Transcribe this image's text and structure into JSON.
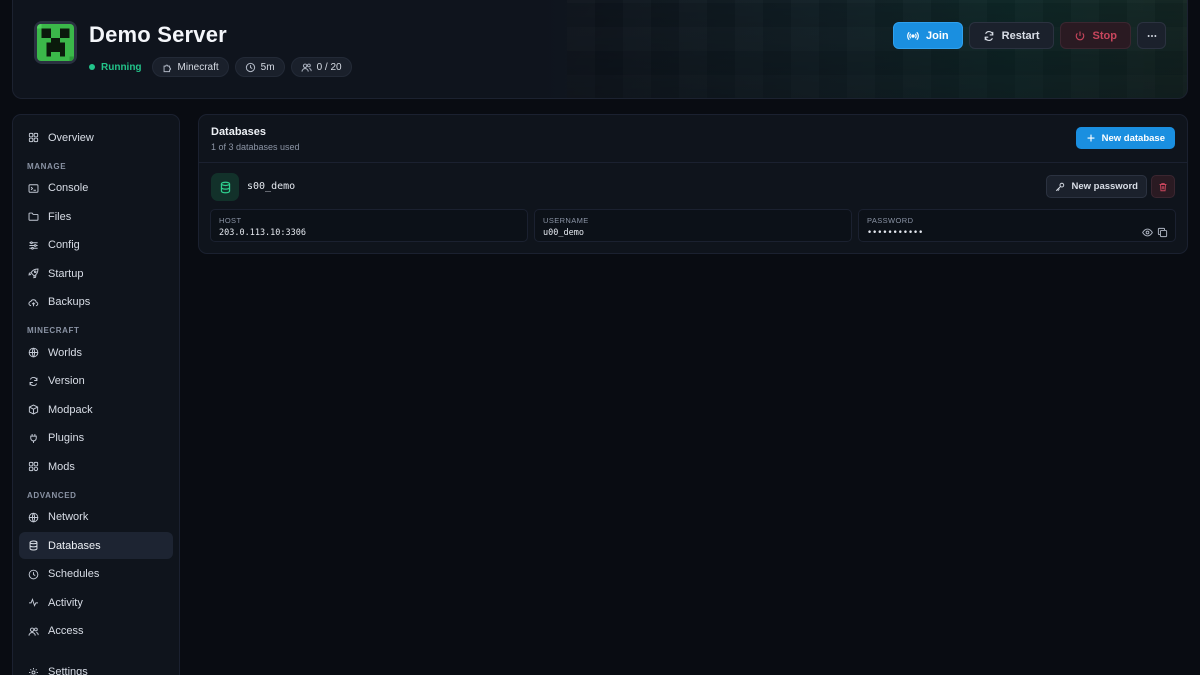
{
  "header": {
    "title": "Demo Server",
    "status": "Running",
    "game": "Minecraft",
    "uptime": "5m",
    "players": "0 / 20",
    "buttons": {
      "join": "Join",
      "restart": "Restart",
      "stop": "Stop"
    }
  },
  "sidebar": {
    "overview": "Overview",
    "sections": {
      "manage": "MANAGE",
      "minecraft": "MINECRAFT",
      "advanced": "ADVANCED"
    },
    "manage_items": [
      "Console",
      "Files",
      "Config",
      "Startup",
      "Backups"
    ],
    "minecraft_items": [
      "Worlds",
      "Version",
      "Modpack",
      "Plugins",
      "Mods"
    ],
    "advanced_items": [
      "Network",
      "Databases",
      "Schedules",
      "Activity",
      "Access"
    ],
    "settings": "Settings",
    "active": "Databases"
  },
  "databases": {
    "title": "Databases",
    "subtitle": "1 of 3 databases used",
    "new_button": "New database",
    "items": [
      {
        "name": "s00_demo",
        "new_password_label": "New password",
        "host_label": "HOST",
        "host": "203.0.113.10:3306",
        "username_label": "USERNAME",
        "username": "u00_demo",
        "password_label": "PASSWORD",
        "password": "•••••••••••"
      }
    ]
  },
  "colors": {
    "accent": "#1a8fe0",
    "status_green": "#22c48a",
    "danger": "#c9465d"
  }
}
